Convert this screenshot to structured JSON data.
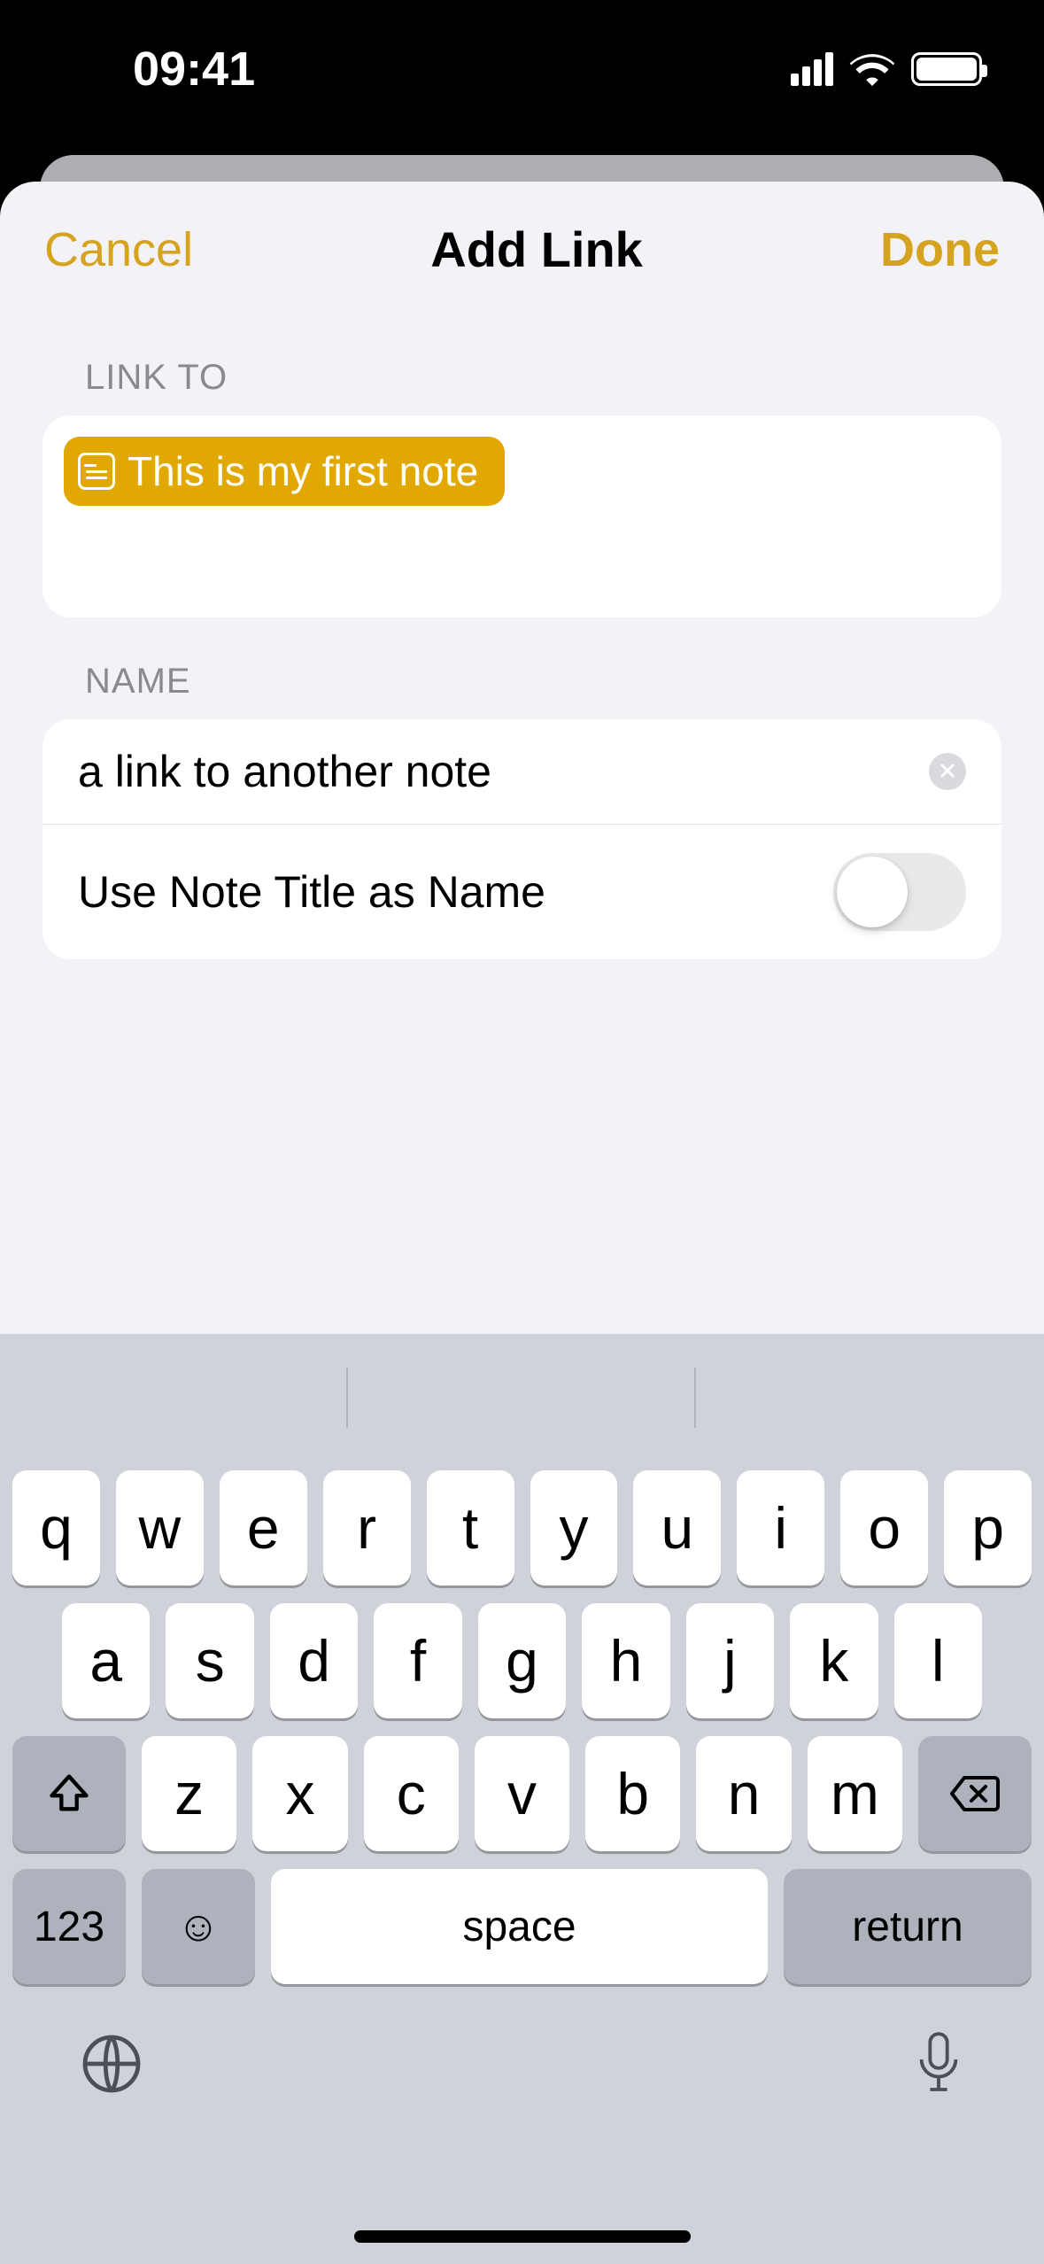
{
  "statusbar": {
    "time": "09:41"
  },
  "sheet": {
    "cancel": "Cancel",
    "title": "Add Link",
    "done": "Done",
    "linkto_label": "LINK TO",
    "linkto_chip": "This is my first note",
    "name_label": "NAME",
    "name_value": "a link to another note",
    "toggle_label": "Use Note Title as Name",
    "toggle_on": false
  },
  "keyboard": {
    "row1": [
      "q",
      "w",
      "e",
      "r",
      "t",
      "y",
      "u",
      "i",
      "o",
      "p"
    ],
    "row2": [
      "a",
      "s",
      "d",
      "f",
      "g",
      "h",
      "j",
      "k",
      "l"
    ],
    "row3": [
      "z",
      "x",
      "c",
      "v",
      "b",
      "n",
      "m"
    ],
    "numkey": "123",
    "space": "space",
    "return": "return"
  }
}
